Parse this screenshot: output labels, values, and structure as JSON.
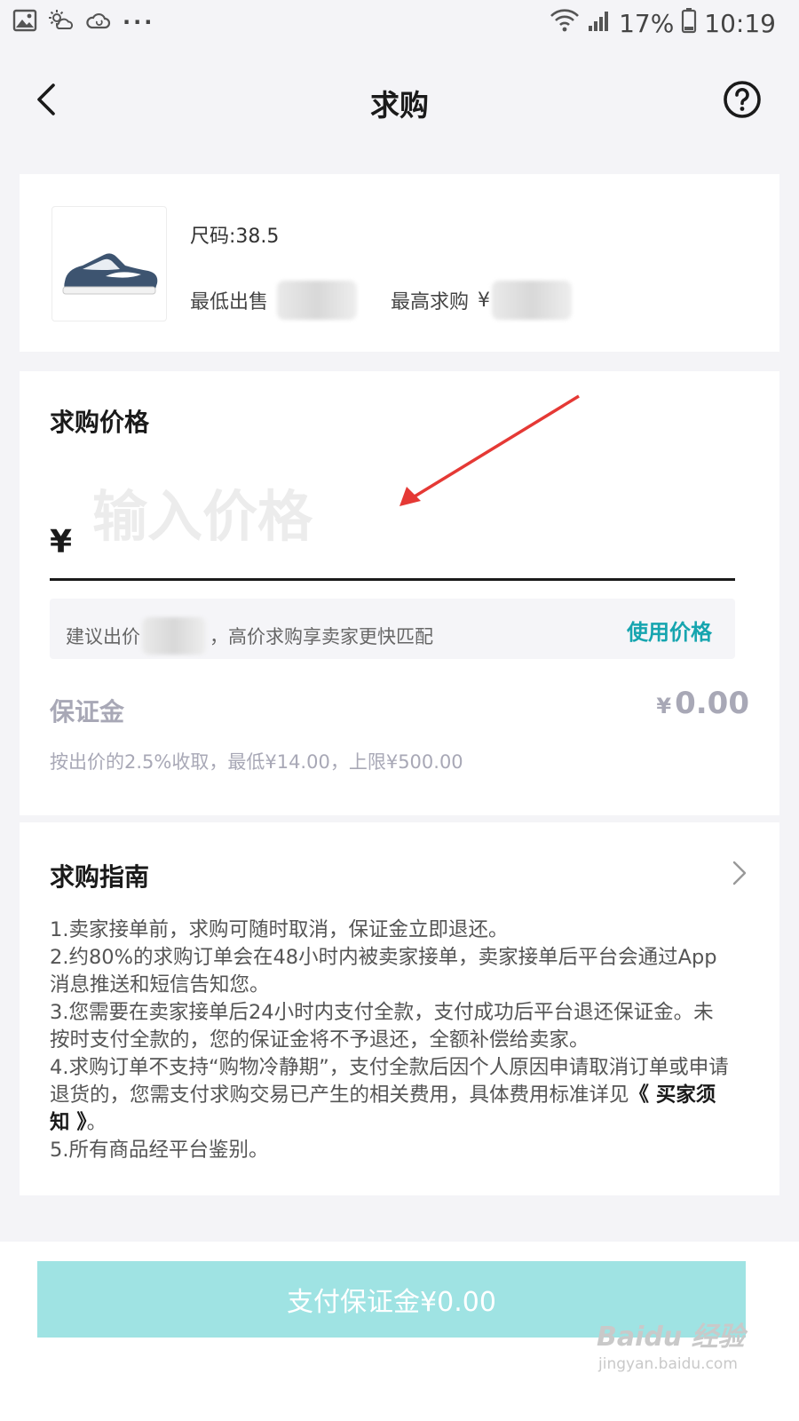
{
  "status_bar": {
    "battery": "17%",
    "time": "10:19",
    "more": "···",
    "icons": [
      "gallery-icon",
      "weather-icon",
      "cloud-sync-icon",
      "wifi-icon",
      "signal-icon",
      "battery-icon"
    ]
  },
  "nav": {
    "title": "求购",
    "back_icon": "chevron-left-icon",
    "help_icon": "help-circle-icon"
  },
  "product": {
    "size": "尺码:38.5",
    "lowest_sell_label": "最低出售",
    "highest_bid_label": "最高求购",
    "highest_bid_currency": "¥",
    "image": "sneaker-image"
  },
  "bid_price": {
    "title": "求购价格",
    "currency": "¥",
    "input_value": "",
    "placeholder": "输入价格",
    "suggest_prefix": "建议出价",
    "suggest_suffix": "，高价求购享卖家更快匹配",
    "use_price_label": "使用价格",
    "deposit_label": "保证金",
    "deposit_currency": "¥",
    "deposit_amount": "0.00",
    "deposit_note": "按出价的2.5%收取，最低¥14.00，上限¥500.00"
  },
  "guide": {
    "title": "求购指南",
    "item_1": "1.卖家接单前，求购可随时取消，保证金立即退还。",
    "item_2": "2.约80%的求购订单会在48小时内被卖家接单，卖家接单后平台会通过App消息推送和短信告知您。",
    "item_3": "3.您需要在卖家接单后24小时内支付全款，支付成功后平台退还保证金。未按时支付全款的，您的保证金将不予退还，全额补偿给卖家。",
    "item_4_text": "4.求购订单不支持“购物冷静期”，支付全款后因个人原因申请取消订单或申请退货的，您需支付求购交易已产生的相关费用，具体费用标准详见",
    "item_4_link": "《 买家须知 》",
    "item_4_end": "。",
    "item_5": "5.所有商品经平台鉴别。"
  },
  "footer": {
    "pay_button_label": "支付保证金¥0.00"
  },
  "watermark": {
    "main": "Baidu 经验",
    "sub": "jingyan.baidu.com"
  },
  "colors": {
    "accent": "#16a5af",
    "pay_button_disabled": "#9fe3e3",
    "annotation_arrow": "#e53935"
  }
}
